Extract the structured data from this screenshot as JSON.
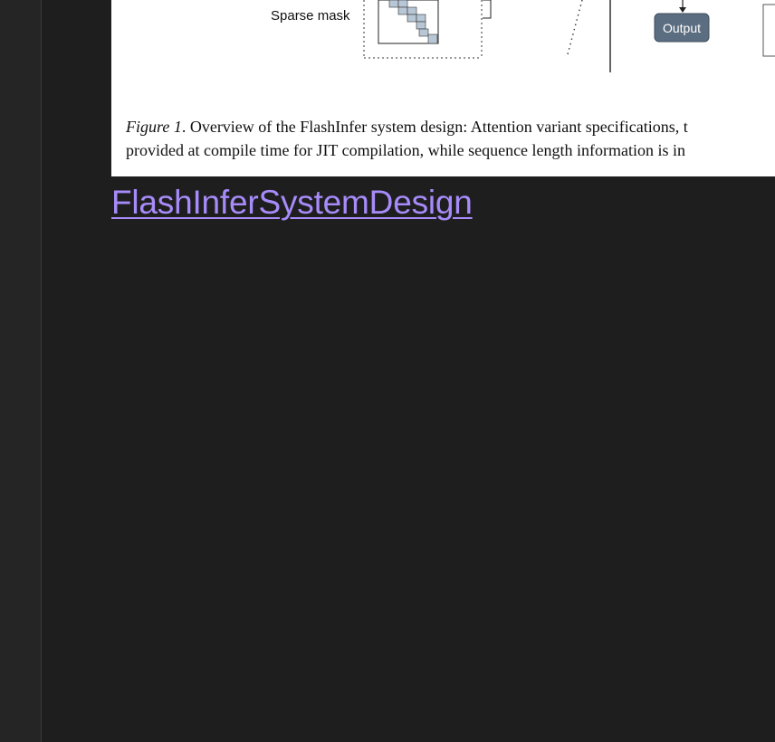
{
  "figure": {
    "diagram": {
      "sparse_mask_label": "Sparse mask",
      "output_label": "Output"
    },
    "caption": {
      "lead": "Figure 1",
      "line1_rest": ". Overview of the FlashInfer system design: Attention variant specifications, t",
      "line2": "provided at compile time for JIT compilation, while sequence length information is in"
    }
  },
  "embed": {
    "link_text": "FlashInferSystemDesign"
  },
  "colors": {
    "background": "#1e1e1e",
    "sidebar": "#252525",
    "link": "#a78bfa",
    "output_box": "#5b6d80"
  }
}
